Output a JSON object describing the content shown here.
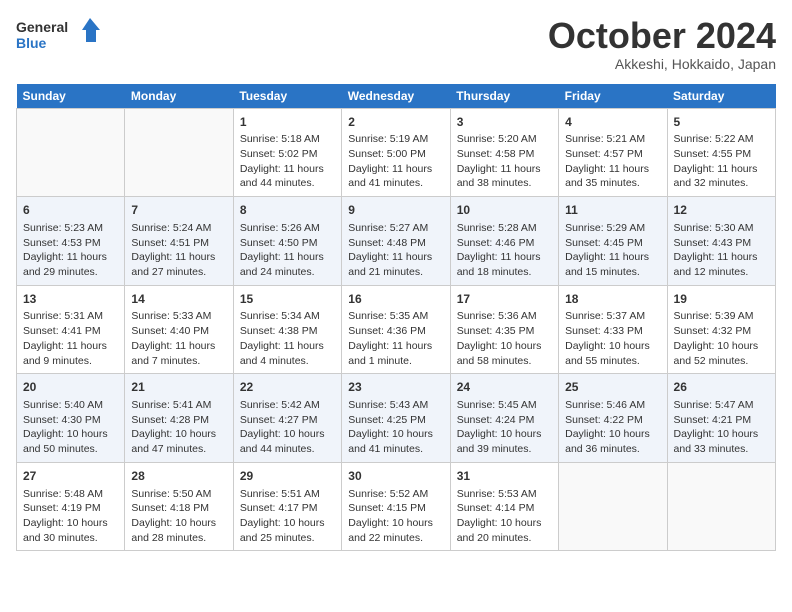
{
  "header": {
    "logo_line1": "General",
    "logo_line2": "Blue",
    "month": "October 2024",
    "location": "Akkeshi, Hokkaido, Japan"
  },
  "weekdays": [
    "Sunday",
    "Monday",
    "Tuesday",
    "Wednesday",
    "Thursday",
    "Friday",
    "Saturday"
  ],
  "weeks": [
    [
      {
        "day": "",
        "info": ""
      },
      {
        "day": "",
        "info": ""
      },
      {
        "day": "1",
        "info": "Sunrise: 5:18 AM\nSunset: 5:02 PM\nDaylight: 11 hours\nand 44 minutes."
      },
      {
        "day": "2",
        "info": "Sunrise: 5:19 AM\nSunset: 5:00 PM\nDaylight: 11 hours\nand 41 minutes."
      },
      {
        "day": "3",
        "info": "Sunrise: 5:20 AM\nSunset: 4:58 PM\nDaylight: 11 hours\nand 38 minutes."
      },
      {
        "day": "4",
        "info": "Sunrise: 5:21 AM\nSunset: 4:57 PM\nDaylight: 11 hours\nand 35 minutes."
      },
      {
        "day": "5",
        "info": "Sunrise: 5:22 AM\nSunset: 4:55 PM\nDaylight: 11 hours\nand 32 minutes."
      }
    ],
    [
      {
        "day": "6",
        "info": "Sunrise: 5:23 AM\nSunset: 4:53 PM\nDaylight: 11 hours\nand 29 minutes."
      },
      {
        "day": "7",
        "info": "Sunrise: 5:24 AM\nSunset: 4:51 PM\nDaylight: 11 hours\nand 27 minutes."
      },
      {
        "day": "8",
        "info": "Sunrise: 5:26 AM\nSunset: 4:50 PM\nDaylight: 11 hours\nand 24 minutes."
      },
      {
        "day": "9",
        "info": "Sunrise: 5:27 AM\nSunset: 4:48 PM\nDaylight: 11 hours\nand 21 minutes."
      },
      {
        "day": "10",
        "info": "Sunrise: 5:28 AM\nSunset: 4:46 PM\nDaylight: 11 hours\nand 18 minutes."
      },
      {
        "day": "11",
        "info": "Sunrise: 5:29 AM\nSunset: 4:45 PM\nDaylight: 11 hours\nand 15 minutes."
      },
      {
        "day": "12",
        "info": "Sunrise: 5:30 AM\nSunset: 4:43 PM\nDaylight: 11 hours\nand 12 minutes."
      }
    ],
    [
      {
        "day": "13",
        "info": "Sunrise: 5:31 AM\nSunset: 4:41 PM\nDaylight: 11 hours\nand 9 minutes."
      },
      {
        "day": "14",
        "info": "Sunrise: 5:33 AM\nSunset: 4:40 PM\nDaylight: 11 hours\nand 7 minutes."
      },
      {
        "day": "15",
        "info": "Sunrise: 5:34 AM\nSunset: 4:38 PM\nDaylight: 11 hours\nand 4 minutes."
      },
      {
        "day": "16",
        "info": "Sunrise: 5:35 AM\nSunset: 4:36 PM\nDaylight: 11 hours\nand 1 minute."
      },
      {
        "day": "17",
        "info": "Sunrise: 5:36 AM\nSunset: 4:35 PM\nDaylight: 10 hours\nand 58 minutes."
      },
      {
        "day": "18",
        "info": "Sunrise: 5:37 AM\nSunset: 4:33 PM\nDaylight: 10 hours\nand 55 minutes."
      },
      {
        "day": "19",
        "info": "Sunrise: 5:39 AM\nSunset: 4:32 PM\nDaylight: 10 hours\nand 52 minutes."
      }
    ],
    [
      {
        "day": "20",
        "info": "Sunrise: 5:40 AM\nSunset: 4:30 PM\nDaylight: 10 hours\nand 50 minutes."
      },
      {
        "day": "21",
        "info": "Sunrise: 5:41 AM\nSunset: 4:28 PM\nDaylight: 10 hours\nand 47 minutes."
      },
      {
        "day": "22",
        "info": "Sunrise: 5:42 AM\nSunset: 4:27 PM\nDaylight: 10 hours\nand 44 minutes."
      },
      {
        "day": "23",
        "info": "Sunrise: 5:43 AM\nSunset: 4:25 PM\nDaylight: 10 hours\nand 41 minutes."
      },
      {
        "day": "24",
        "info": "Sunrise: 5:45 AM\nSunset: 4:24 PM\nDaylight: 10 hours\nand 39 minutes."
      },
      {
        "day": "25",
        "info": "Sunrise: 5:46 AM\nSunset: 4:22 PM\nDaylight: 10 hours\nand 36 minutes."
      },
      {
        "day": "26",
        "info": "Sunrise: 5:47 AM\nSunset: 4:21 PM\nDaylight: 10 hours\nand 33 minutes."
      }
    ],
    [
      {
        "day": "27",
        "info": "Sunrise: 5:48 AM\nSunset: 4:19 PM\nDaylight: 10 hours\nand 30 minutes."
      },
      {
        "day": "28",
        "info": "Sunrise: 5:50 AM\nSunset: 4:18 PM\nDaylight: 10 hours\nand 28 minutes."
      },
      {
        "day": "29",
        "info": "Sunrise: 5:51 AM\nSunset: 4:17 PM\nDaylight: 10 hours\nand 25 minutes."
      },
      {
        "day": "30",
        "info": "Sunrise: 5:52 AM\nSunset: 4:15 PM\nDaylight: 10 hours\nand 22 minutes."
      },
      {
        "day": "31",
        "info": "Sunrise: 5:53 AM\nSunset: 4:14 PM\nDaylight: 10 hours\nand 20 minutes."
      },
      {
        "day": "",
        "info": ""
      },
      {
        "day": "",
        "info": ""
      }
    ]
  ]
}
